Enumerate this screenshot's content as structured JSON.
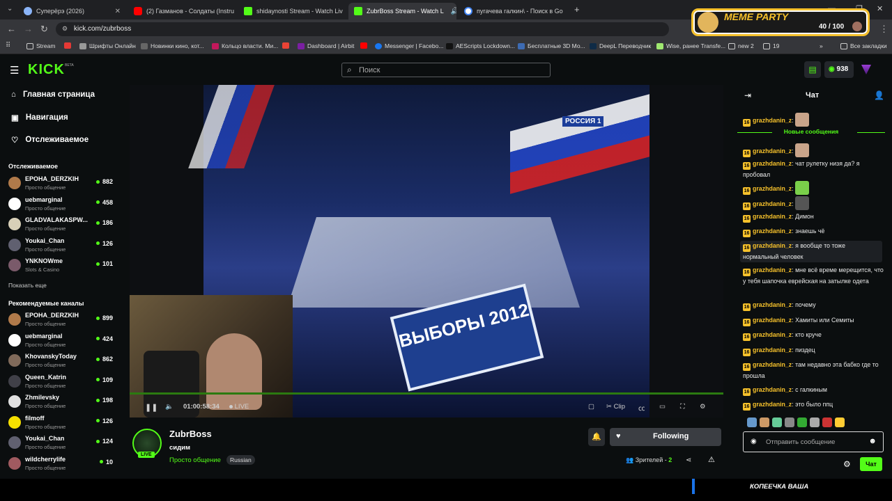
{
  "browser": {
    "tabs": [
      {
        "label": "Суперёрэ (2026)",
        "color": "#8ab4f8"
      },
      {
        "label": "(2) Газманов - Солдаты (Instru",
        "color": "#ff0000"
      },
      {
        "label": "shidaynosti Stream - Watch Liv",
        "color": "#53fc18"
      },
      {
        "label": "ZubrBoss Stream - Watch L",
        "color": "#53fc18"
      },
      {
        "label": "пугачева галкин\\ - Поиск в Go",
        "color": "#4285f4"
      }
    ],
    "url": "kick.com/zubrboss",
    "bookmarks": [
      "Stream",
      "",
      "Шрифты Онлайн",
      "Новинки кино, кот...",
      "Кольцо власти. Ми...",
      "",
      "Dashboard | Airbit",
      "",
      "Messenger | Facebo...",
      "AEScripts Lockdown...",
      "Бесплатные 3D Мо...",
      "DeepL Переводчик",
      "Wise, ранее Transfe...",
      "new 2",
      "19",
      "Все закладки"
    ]
  },
  "meme_overlay": {
    "title": "MEME PARTY",
    "progress": "40 / 100"
  },
  "header": {
    "logo": "KICK",
    "beta": "BETA",
    "search_placeholder": "Поиск",
    "points": "938"
  },
  "sidebar": {
    "nav": [
      "Главная страница",
      "Навигация",
      "Отслеживаемое"
    ],
    "followed_title": "Отслеживаемое",
    "followed": [
      {
        "name": "EPOHA_DERZKIH",
        "category": "Просто общение",
        "viewers": "882",
        "color": "#b07a4a"
      },
      {
        "name": "uebmarginal",
        "category": "Просто общение",
        "viewers": "458",
        "color": "#ffffff"
      },
      {
        "name": "GLADVALAKASPW...",
        "category": "Просто общение",
        "viewers": "186",
        "color": "#d8d0b8"
      },
      {
        "name": "Youkai_Chan",
        "category": "Просто общение",
        "viewers": "126",
        "color": "#606070"
      },
      {
        "name": "YNKNOWme",
        "category": "Slots & Casino",
        "viewers": "101",
        "color": "#7a5a6a"
      }
    ],
    "show_more": "Показать еще",
    "recommended_title": "Рекомендуемые каналы",
    "recommended": [
      {
        "name": "EPOHA_DERZKIH",
        "category": "Просто общение",
        "viewers": "899",
        "color": "#b07a4a"
      },
      {
        "name": "uebmarginal",
        "category": "Просто общение",
        "viewers": "424",
        "color": "#ffffff"
      },
      {
        "name": "KhovanskyToday",
        "category": "Просто общение",
        "viewers": "862",
        "color": "#806a5a"
      },
      {
        "name": "Queen_Katrin",
        "category": "Просто общение",
        "viewers": "109",
        "color": "#404048"
      },
      {
        "name": "Zhmilevsky",
        "category": "Просто общение",
        "viewers": "198",
        "color": "#e0e0e0"
      },
      {
        "name": "filmoff",
        "category": "Просто общение",
        "viewers": "126",
        "color": "#f6e000"
      },
      {
        "name": "Youkai_Chan",
        "category": "Просто общение",
        "viewers": "124",
        "color": "#606070"
      },
      {
        "name": "wildcherrylife",
        "category": "Просто общение",
        "viewers": "10",
        "color": "#a05a60"
      }
    ]
  },
  "video": {
    "time": "01:00:58:34",
    "live": "LIVE",
    "clip": "Clip",
    "banner": "ВЫБОРЫ 2012",
    "channel_logo": "РОССИЯ 1"
  },
  "channel": {
    "name": "ZubrBoss",
    "title": "сидим",
    "category": "Просто общение",
    "language": "Russian",
    "follow_label": "Following",
    "viewers_label": "Зрителей -",
    "viewers": "2",
    "live_badge": "LIVE"
  },
  "chat": {
    "title": "Чат",
    "new_messages": "Новые сообщения",
    "messages": [
      {
        "user": "grazhdanin_z",
        "text": "",
        "emote": true
      },
      {
        "user": "grazhdanin_z",
        "text": "",
        "emote": true
      },
      {
        "user": "grazhdanin_z",
        "text": "чат рулетку низя да? я пробовал"
      },
      {
        "user": "grazhdanin_z",
        "text": "",
        "emote": true
      },
      {
        "user": "grazhdanin_z",
        "text": "",
        "emote": true
      },
      {
        "user": "grazhdanin_z",
        "text": "Димон"
      },
      {
        "user": "grazhdanin_z",
        "text": "знаешь чё"
      },
      {
        "user": "grazhdanin_z",
        "text": "я вообще то тоже нормальный человек"
      },
      {
        "user": "grazhdanin_z",
        "text": "мне всё време мерещится, что у тебя шапочка еврейская на затылке одета"
      },
      {
        "user": "grazhdanin_z",
        "text": "почему"
      },
      {
        "user": "grazhdanin_z",
        "text": "Хамиты или Семиты"
      },
      {
        "user": "grazhdanin_z",
        "text": "кто круче"
      },
      {
        "user": "grazhdanin_z",
        "text": "пиздец"
      },
      {
        "user": "grazhdanin_z",
        "text": "там недавно эта бабко где то прошла"
      },
      {
        "user": "grazhdanin_z",
        "text": "с галкиным"
      },
      {
        "user": "grazhdanin_z",
        "text": "это было ппц"
      }
    ],
    "badge": "16",
    "input_placeholder": "Отправить сообщение",
    "send_label": "Чат"
  },
  "footer_text": "КОПЕЕЧКА ВАША"
}
